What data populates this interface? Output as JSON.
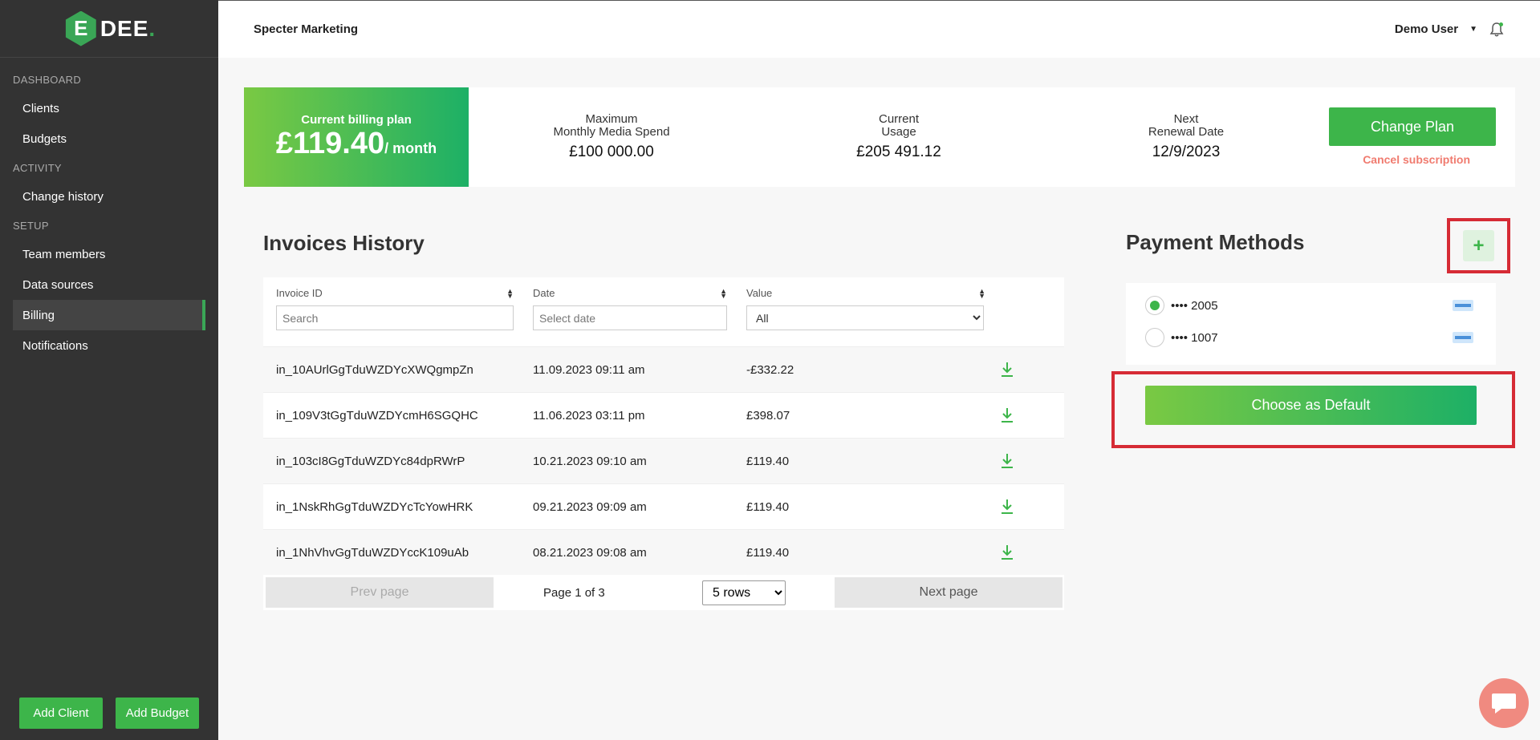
{
  "logo": {
    "letter": "E",
    "text": "DEE",
    "dot": "."
  },
  "sidebar": {
    "sections": [
      {
        "label": "DASHBOARD",
        "items": [
          {
            "label": "Clients"
          },
          {
            "label": "Budgets"
          }
        ]
      },
      {
        "label": "ACTIVITY",
        "items": [
          {
            "label": "Change history"
          }
        ]
      },
      {
        "label": "SETUP",
        "items": [
          {
            "label": "Team members"
          },
          {
            "label": "Data sources"
          },
          {
            "label": "Billing",
            "active": true
          },
          {
            "label": "Notifications"
          }
        ]
      }
    ],
    "add_client": "Add Client",
    "add_budget": "Add Budget"
  },
  "header": {
    "company": "Specter Marketing",
    "user": "Demo User"
  },
  "plan": {
    "label": "Current billing plan",
    "amount": "£119.40",
    "per": "/ month",
    "max_label_1": "Maximum",
    "max_label_2": "Monthly Media Spend",
    "max_value": "£100 000.00",
    "usage_label_1": "Current",
    "usage_label_2": "Usage",
    "usage_value": "£205 491.12",
    "renewal_label_1": "Next",
    "renewal_label_2": "Renewal Date",
    "renewal_value": "12/9/2023",
    "change_plan": "Change Plan",
    "cancel": "Cancel subscription"
  },
  "invoices": {
    "title": "Invoices History",
    "columns": {
      "id": "Invoice ID",
      "date": "Date",
      "value": "Value"
    },
    "search_placeholder": "Search",
    "date_placeholder": "Select date",
    "value_filter": "All",
    "rows": [
      {
        "id": "in_10AUrlGgTduWZDYcXWQgmpZn",
        "date": "11.09.2023 09:11 am",
        "value": "-£332.22"
      },
      {
        "id": "in_109V3tGgTduWZDYcmH6SGQHC",
        "date": "11.06.2023 03:11 pm",
        "value": "£398.07"
      },
      {
        "id": "in_103cI8GgTduWZDYc84dpRWrP",
        "date": "10.21.2023 09:10 am",
        "value": "£119.40"
      },
      {
        "id": "in_1NskRhGgTduWZDYcTcYowHRK",
        "date": "09.21.2023 09:09 am",
        "value": "£119.40"
      },
      {
        "id": "in_1NhVhvGgTduWZDYccK109uAb",
        "date": "08.21.2023 09:08 am",
        "value": "£119.40"
      }
    ],
    "prev": "Prev page",
    "page_info": "Page 1 of 3",
    "rows_option": "5 rows",
    "next": "Next page"
  },
  "payment": {
    "title": "Payment Methods",
    "add": "+",
    "cards": [
      {
        "label": "•••• 2005",
        "selected": true
      },
      {
        "label": "•••• 1007",
        "selected": false
      }
    ],
    "default_btn": "Choose as Default"
  },
  "colors": {
    "accent": "#3db54a",
    "sidebar": "#333333",
    "highlight": "#d62b35",
    "cancel": "#f07b6f"
  }
}
